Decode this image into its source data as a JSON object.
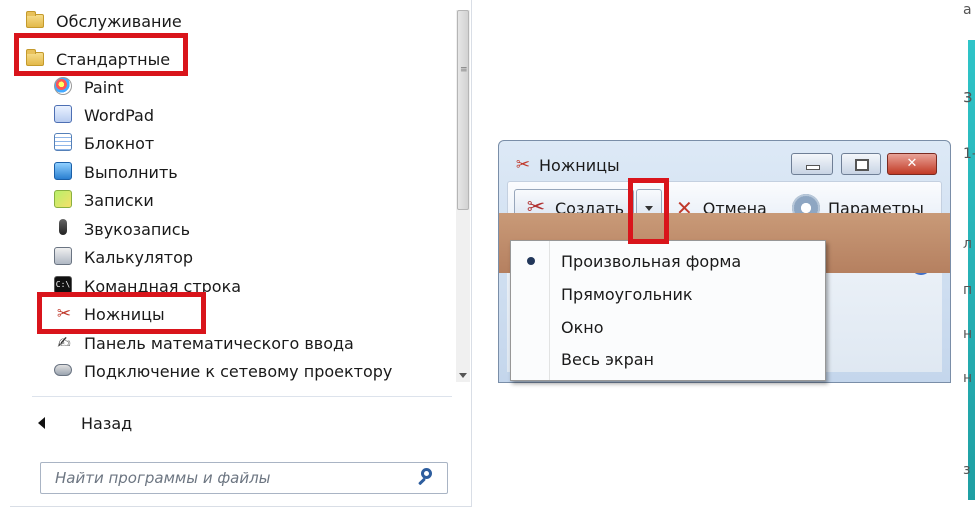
{
  "start_menu": {
    "items": [
      {
        "label": "Обслуживание",
        "icon": "folder-icon",
        "type": "folder"
      },
      {
        "label": "Стандартные",
        "icon": "folder-icon",
        "type": "folder"
      },
      {
        "label": "Paint",
        "icon": "paint-icon",
        "type": "sub"
      },
      {
        "label": "WordPad",
        "icon": "wordpad-icon",
        "type": "sub"
      },
      {
        "label": "Блокнот",
        "icon": "notepad-icon",
        "type": "sub"
      },
      {
        "label": "Выполнить",
        "icon": "run-icon",
        "type": "sub"
      },
      {
        "label": "Записки",
        "icon": "sticky-notes-icon",
        "type": "sub"
      },
      {
        "label": "Звукозапись",
        "icon": "microphone-icon",
        "type": "sub"
      },
      {
        "label": "Калькулятор",
        "icon": "calculator-icon",
        "type": "sub"
      },
      {
        "label": "Командная строка",
        "icon": "command-prompt-icon",
        "type": "sub"
      },
      {
        "label": "Ножницы",
        "icon": "scissors-icon",
        "type": "sub"
      },
      {
        "label": "Панель математического ввода",
        "icon": "math-input-icon",
        "type": "sub"
      },
      {
        "label": "Подключение к сетевому проектору",
        "icon": "projector-icon",
        "type": "sub"
      }
    ],
    "back_label": "Назад",
    "search_placeholder": "Найти программы и файлы",
    "cmd_icon_text": "C:\\"
  },
  "snipping_tool": {
    "title": "Ножницы",
    "new_label": "Создать",
    "cancel_label": "Отмена",
    "options_label": "Параметры",
    "close_glyph": "✕",
    "help_glyph": "?",
    "dropdown_items": [
      {
        "label": "Произвольная форма",
        "selected": true
      },
      {
        "label": "Прямоугольник",
        "selected": false
      },
      {
        "label": "Окно",
        "selected": false
      },
      {
        "label": "Весь экран",
        "selected": false
      }
    ]
  },
  "right_edge_chars": [
    "а",
    "з",
    "1-",
    "л",
    "п",
    "н",
    "н",
    "з"
  ],
  "colors": {
    "highlight": "#d9141b",
    "accent": "#2d5d9e"
  }
}
